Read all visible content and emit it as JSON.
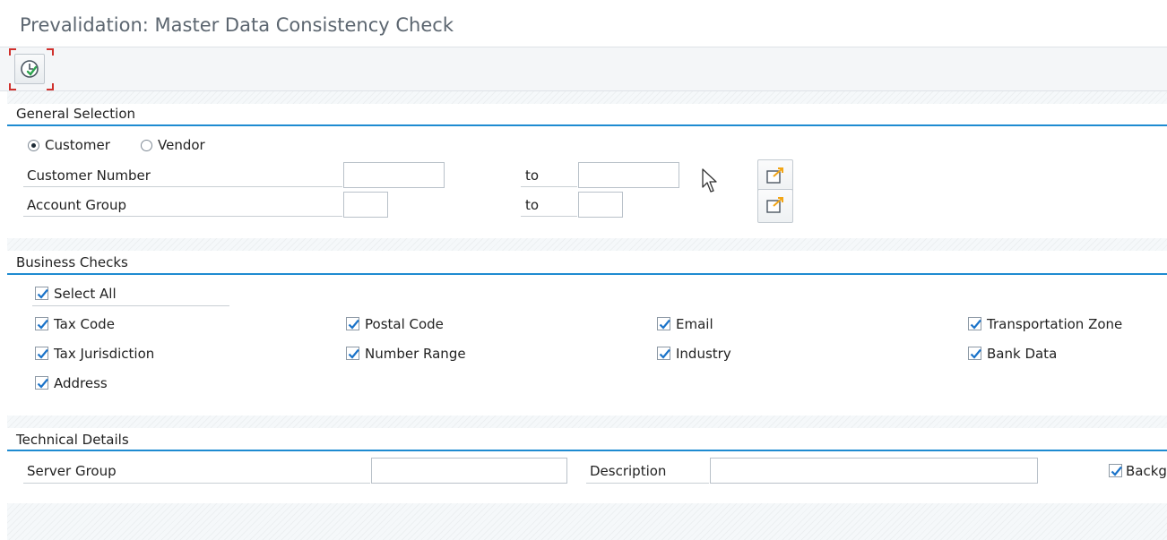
{
  "window": {
    "title": "Prevalidation: Master Data Consistency Check"
  },
  "toolbar": {
    "execute_icon": "execute-clock-icon"
  },
  "general_selection": {
    "header": "General Selection",
    "radio_customer": "Customer",
    "radio_vendor": "Vendor",
    "selected": "Customer",
    "customer_number_label": "Customer Number",
    "account_group_label": "Account Group",
    "to_label_1": "to",
    "to_label_2": "to",
    "customer_number_from": "",
    "customer_number_to": "",
    "account_group_from": "",
    "account_group_to": ""
  },
  "business_checks": {
    "header": "Business Checks",
    "select_all": "Select All",
    "items": [
      {
        "label": "Tax Code",
        "checked": true
      },
      {
        "label": "Postal Code",
        "checked": true
      },
      {
        "label": "Email",
        "checked": true
      },
      {
        "label": "Transportation Zone",
        "checked": true
      },
      {
        "label": "Tax Jurisdiction",
        "checked": true
      },
      {
        "label": "Number Range",
        "checked": true
      },
      {
        "label": "Industry",
        "checked": true
      },
      {
        "label": "Bank Data",
        "checked": true
      },
      {
        "label": "Address",
        "checked": true
      }
    ]
  },
  "technical_details": {
    "header": "Technical Details",
    "server_group_label": "Server Group",
    "description_label": "Description",
    "background_label": "Backg",
    "server_group_value": "",
    "description_value": "",
    "background_checked": true
  },
  "colors": {
    "accent": "#1e8bd1",
    "check": "#1a73c9",
    "highlight": "#d0312d"
  }
}
